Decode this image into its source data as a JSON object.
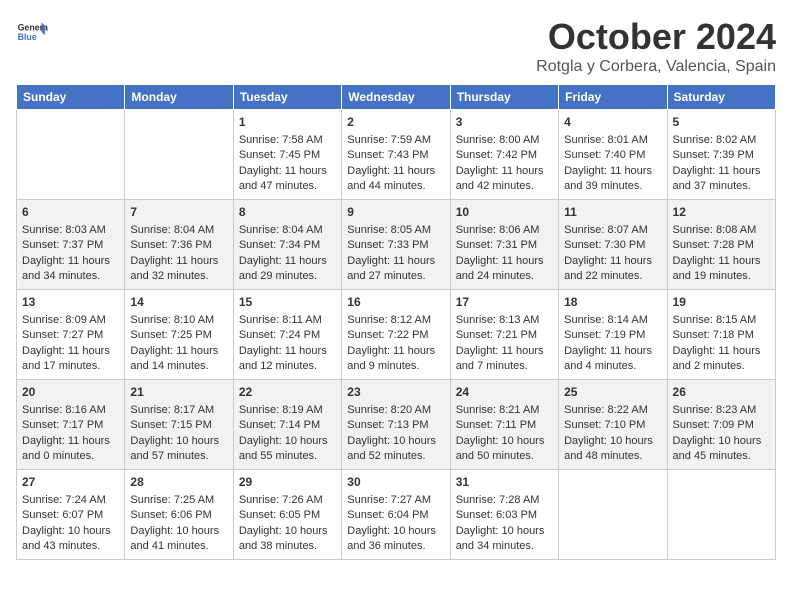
{
  "logo": {
    "line1": "General",
    "line2": "Blue"
  },
  "header": {
    "month": "October 2024",
    "location": "Rotgla y Corbera, Valencia, Spain"
  },
  "weekdays": [
    "Sunday",
    "Monday",
    "Tuesday",
    "Wednesday",
    "Thursday",
    "Friday",
    "Saturday"
  ],
  "weeks": [
    [
      {
        "day": "",
        "content": ""
      },
      {
        "day": "",
        "content": ""
      },
      {
        "day": "1",
        "content": "Sunrise: 7:58 AM\nSunset: 7:45 PM\nDaylight: 11 hours and 47 minutes."
      },
      {
        "day": "2",
        "content": "Sunrise: 7:59 AM\nSunset: 7:43 PM\nDaylight: 11 hours and 44 minutes."
      },
      {
        "day": "3",
        "content": "Sunrise: 8:00 AM\nSunset: 7:42 PM\nDaylight: 11 hours and 42 minutes."
      },
      {
        "day": "4",
        "content": "Sunrise: 8:01 AM\nSunset: 7:40 PM\nDaylight: 11 hours and 39 minutes."
      },
      {
        "day": "5",
        "content": "Sunrise: 8:02 AM\nSunset: 7:39 PM\nDaylight: 11 hours and 37 minutes."
      }
    ],
    [
      {
        "day": "6",
        "content": "Sunrise: 8:03 AM\nSunset: 7:37 PM\nDaylight: 11 hours and 34 minutes."
      },
      {
        "day": "7",
        "content": "Sunrise: 8:04 AM\nSunset: 7:36 PM\nDaylight: 11 hours and 32 minutes."
      },
      {
        "day": "8",
        "content": "Sunrise: 8:04 AM\nSunset: 7:34 PM\nDaylight: 11 hours and 29 minutes."
      },
      {
        "day": "9",
        "content": "Sunrise: 8:05 AM\nSunset: 7:33 PM\nDaylight: 11 hours and 27 minutes."
      },
      {
        "day": "10",
        "content": "Sunrise: 8:06 AM\nSunset: 7:31 PM\nDaylight: 11 hours and 24 minutes."
      },
      {
        "day": "11",
        "content": "Sunrise: 8:07 AM\nSunset: 7:30 PM\nDaylight: 11 hours and 22 minutes."
      },
      {
        "day": "12",
        "content": "Sunrise: 8:08 AM\nSunset: 7:28 PM\nDaylight: 11 hours and 19 minutes."
      }
    ],
    [
      {
        "day": "13",
        "content": "Sunrise: 8:09 AM\nSunset: 7:27 PM\nDaylight: 11 hours and 17 minutes."
      },
      {
        "day": "14",
        "content": "Sunrise: 8:10 AM\nSunset: 7:25 PM\nDaylight: 11 hours and 14 minutes."
      },
      {
        "day": "15",
        "content": "Sunrise: 8:11 AM\nSunset: 7:24 PM\nDaylight: 11 hours and 12 minutes."
      },
      {
        "day": "16",
        "content": "Sunrise: 8:12 AM\nSunset: 7:22 PM\nDaylight: 11 hours and 9 minutes."
      },
      {
        "day": "17",
        "content": "Sunrise: 8:13 AM\nSunset: 7:21 PM\nDaylight: 11 hours and 7 minutes."
      },
      {
        "day": "18",
        "content": "Sunrise: 8:14 AM\nSunset: 7:19 PM\nDaylight: 11 hours and 4 minutes."
      },
      {
        "day": "19",
        "content": "Sunrise: 8:15 AM\nSunset: 7:18 PM\nDaylight: 11 hours and 2 minutes."
      }
    ],
    [
      {
        "day": "20",
        "content": "Sunrise: 8:16 AM\nSunset: 7:17 PM\nDaylight: 11 hours and 0 minutes."
      },
      {
        "day": "21",
        "content": "Sunrise: 8:17 AM\nSunset: 7:15 PM\nDaylight: 10 hours and 57 minutes."
      },
      {
        "day": "22",
        "content": "Sunrise: 8:19 AM\nSunset: 7:14 PM\nDaylight: 10 hours and 55 minutes."
      },
      {
        "day": "23",
        "content": "Sunrise: 8:20 AM\nSunset: 7:13 PM\nDaylight: 10 hours and 52 minutes."
      },
      {
        "day": "24",
        "content": "Sunrise: 8:21 AM\nSunset: 7:11 PM\nDaylight: 10 hours and 50 minutes."
      },
      {
        "day": "25",
        "content": "Sunrise: 8:22 AM\nSunset: 7:10 PM\nDaylight: 10 hours and 48 minutes."
      },
      {
        "day": "26",
        "content": "Sunrise: 8:23 AM\nSunset: 7:09 PM\nDaylight: 10 hours and 45 minutes."
      }
    ],
    [
      {
        "day": "27",
        "content": "Sunrise: 7:24 AM\nSunset: 6:07 PM\nDaylight: 10 hours and 43 minutes."
      },
      {
        "day": "28",
        "content": "Sunrise: 7:25 AM\nSunset: 6:06 PM\nDaylight: 10 hours and 41 minutes."
      },
      {
        "day": "29",
        "content": "Sunrise: 7:26 AM\nSunset: 6:05 PM\nDaylight: 10 hours and 38 minutes."
      },
      {
        "day": "30",
        "content": "Sunrise: 7:27 AM\nSunset: 6:04 PM\nDaylight: 10 hours and 36 minutes."
      },
      {
        "day": "31",
        "content": "Sunrise: 7:28 AM\nSunset: 6:03 PM\nDaylight: 10 hours and 34 minutes."
      },
      {
        "day": "",
        "content": ""
      },
      {
        "day": "",
        "content": ""
      }
    ]
  ]
}
